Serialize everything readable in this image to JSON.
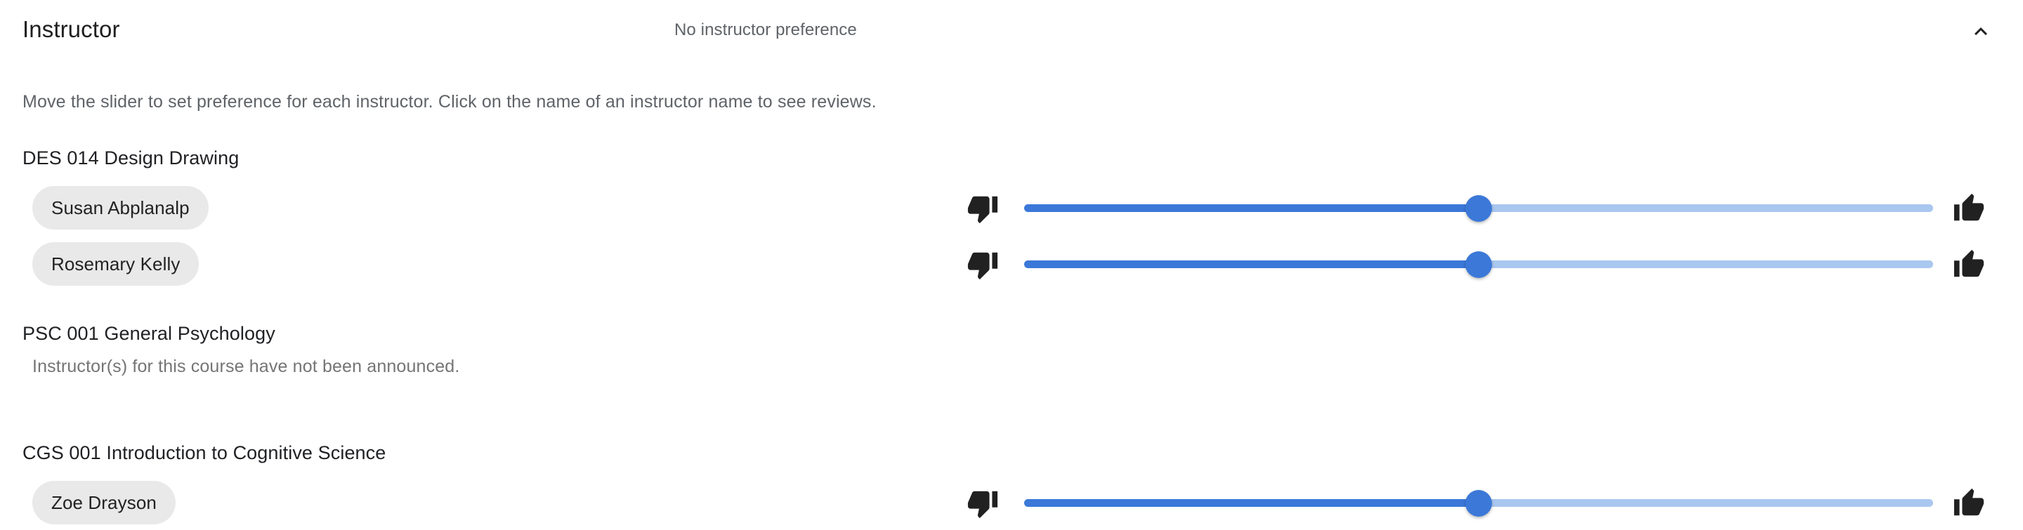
{
  "header": {
    "title": "Instructor",
    "summary": "No instructor preference",
    "collapse_icon": "chevron-up-icon"
  },
  "help_text": "Move the slider to set preference for each instructor. Click on the name of an instructor name to see reviews.",
  "icons": {
    "thumb_down": "thumb-down-icon",
    "thumb_up": "thumb-up-icon"
  },
  "colors": {
    "slider_fill": "#3b78d8",
    "slider_track": "#a9c7ef",
    "slider_thumb": "#3b78d8",
    "chip_background": "#e9e9e9",
    "icon": "#212121"
  },
  "courses": [
    {
      "title": "DES 014 Design Drawing",
      "empty_message": null,
      "instructors": [
        {
          "name": "Susan Abplanalp",
          "slider_value": 50
        },
        {
          "name": "Rosemary Kelly",
          "slider_value": 50
        }
      ]
    },
    {
      "title": "PSC 001 General Psychology",
      "empty_message": "Instructor(s) for this course have not been announced.",
      "instructors": []
    },
    {
      "title": "CGS 001 Introduction to Cognitive Science",
      "empty_message": null,
      "instructors": [
        {
          "name": "Zoe Drayson",
          "slider_value": 50
        }
      ]
    }
  ]
}
